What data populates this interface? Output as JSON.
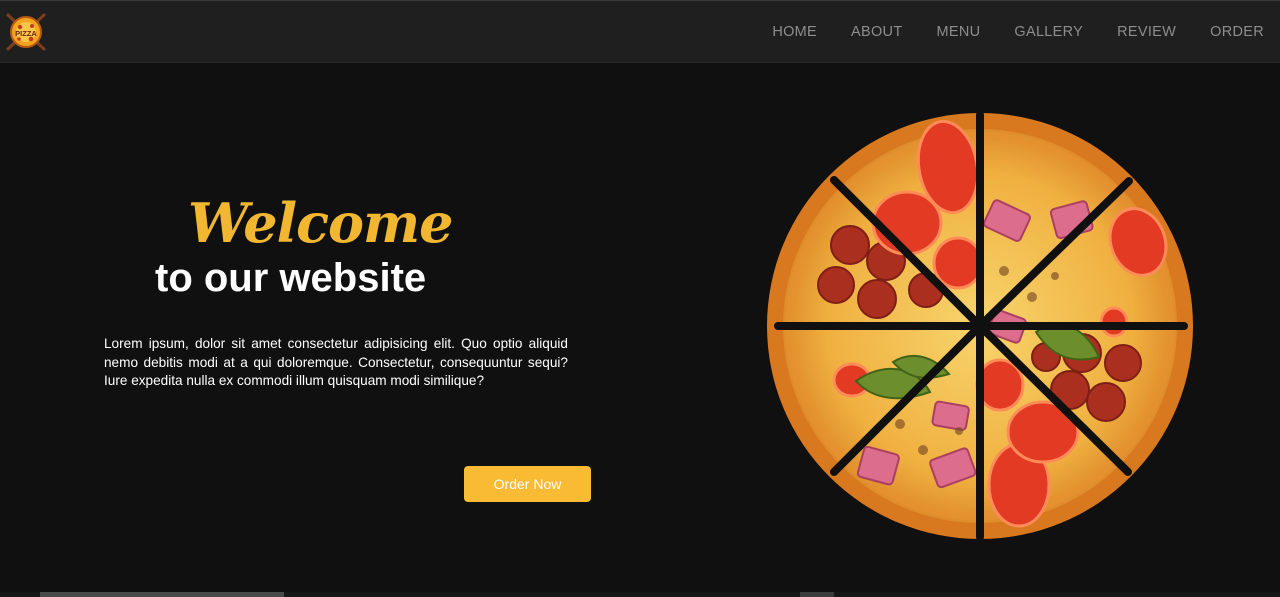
{
  "brand": {
    "logo_text": "PIZZA",
    "logo_icon": "pizza-logo-icon"
  },
  "nav": {
    "items": [
      {
        "label": "HOME"
      },
      {
        "label": "ABOUT"
      },
      {
        "label": "MENU"
      },
      {
        "label": "GALLERY"
      },
      {
        "label": "REVIEW"
      },
      {
        "label": "ORDER"
      }
    ]
  },
  "hero": {
    "welcome": "Welcome",
    "subtitle": "to our website",
    "description": "Lorem ipsum, dolor sit amet consectetur adipisicing elit. Quo optio aliquid nemo debitis modi at a qui doloremque. Consectetur, consequuntur sequi? Iure expedita nulla ex commodi illum quisquam modi similique?",
    "cta_label": "Order Now",
    "image_icon": "pizza-illustration"
  },
  "colors": {
    "accent": "#f2b731",
    "background": "#101010",
    "navbar": "#1f1f1f",
    "nav_text": "#8d8d8d",
    "button": "#f9bb33"
  }
}
